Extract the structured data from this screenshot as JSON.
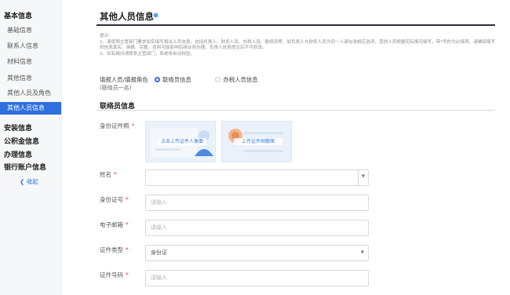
{
  "sidebar": {
    "top_title": "基本信息",
    "items": [
      "基础信息",
      "联系人信息",
      "材料信息",
      "其他信息",
      "其他人员及角色",
      "其他人员信息"
    ],
    "sections": [
      "安装信息",
      "公积金信息",
      "办理信息",
      "银行账户信息"
    ],
    "collapse_label": "收起"
  },
  "page": {
    "title": "其他人员信息"
  },
  "notes": {
    "heading": "提示：",
    "p1": "1、请按照主管部门要求如实填写相关人员信息，包括负责人、财务人员、办税人员、联络员等，如负责人与财务人员为同一人请勾选相应选项，其他人员根据实际情况填写，带*号的为必填项。请确保填写的信息真实、准确、完整，否则可能影响后续业务办理。负责人信息提交后不可修改。",
    "p2": "2、如有疑问请联系主管部门，系统将自动校验。"
  },
  "person_type": {
    "label": "填报人员/填报角色",
    "options": [
      "联络员信息",
      "办税人员信息"
    ],
    "selected_index": 0
  },
  "type_note": "(联络员一名)",
  "section": {
    "title": "联络员信息"
  },
  "form": {
    "id_upload": {
      "label": "身份证件照",
      "front_caption": "点击上传证件人像面",
      "back_caption": "上传证件国徽面"
    },
    "fields": [
      {
        "label": "姓名",
        "placeholder": "",
        "type": "select-boxed"
      },
      {
        "label": "身份证号",
        "placeholder": "请输入",
        "type": "text"
      },
      {
        "label": "电子邮箱",
        "placeholder": "请输入",
        "type": "text"
      },
      {
        "label": "证件类型",
        "placeholder": "身份证",
        "type": "select"
      },
      {
        "label": "证件号码",
        "placeholder": "请输入",
        "type": "text"
      }
    ]
  },
  "colors": {
    "accent": "#2f6fe0",
    "required": "#e2464b",
    "title_rule": "#2d2f3a"
  }
}
